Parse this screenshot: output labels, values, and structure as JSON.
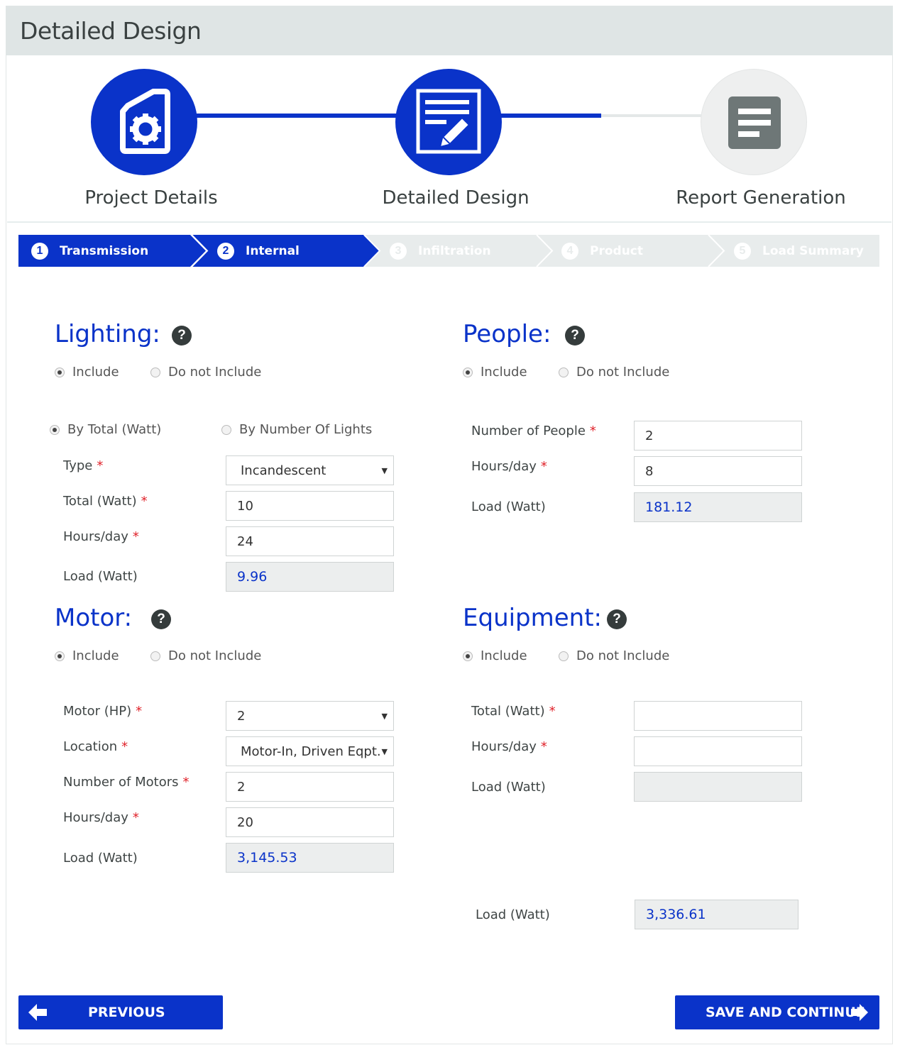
{
  "header": {
    "title": "Detailed Design"
  },
  "steps": [
    {
      "label": "Project Details",
      "icon": "document-gear-icon",
      "state": "complete"
    },
    {
      "label": "Detailed Design",
      "icon": "edit-document-icon",
      "state": "active"
    },
    {
      "label": "Report Generation",
      "icon": "list-document-icon",
      "state": "pending"
    }
  ],
  "crumbs": [
    {
      "num": "1",
      "label": "Transmission"
    },
    {
      "num": "2",
      "label": "Internal"
    },
    {
      "num": "3",
      "label": "Infiltration"
    },
    {
      "num": "4",
      "label": "Product"
    },
    {
      "num": "5",
      "label": "Load Summary"
    }
  ],
  "common": {
    "include": "Include",
    "exclude": "Do not Include",
    "required": "*",
    "help": "?"
  },
  "lighting": {
    "title": "Lighting:",
    "mode_total": "By Total (Watt)",
    "mode_count": "By Number Of Lights",
    "type_label": "Type",
    "type_value": "Incandescent",
    "total_label": "Total (Watt)",
    "total_value": "10",
    "hours_label": "Hours/day",
    "hours_value": "24",
    "load_label": "Load (Watt)",
    "load_value": "9.96"
  },
  "people": {
    "title": "People:",
    "number_label": "Number of People",
    "number_value": "2",
    "hours_label": "Hours/day",
    "hours_value": "8",
    "load_label": "Load (Watt)",
    "load_value": "181.12"
  },
  "motor": {
    "title": "Motor:",
    "hp_label": "Motor (HP)",
    "hp_value": "2",
    "location_label": "Location",
    "location_value": "Motor-In, Driven Eqpt.",
    "count_label": "Number of Motors",
    "count_value": "2",
    "hours_label": "Hours/day",
    "hours_value": "20",
    "load_label": "Load (Watt)",
    "load_value": "3,145.53"
  },
  "equipment": {
    "title": "Equipment:",
    "total_label": "Total (Watt)",
    "total_value": "",
    "hours_label": "Hours/day",
    "hours_value": "",
    "load_label": "Load (Watt)",
    "load_value": ""
  },
  "summary": {
    "load_label": "Load (Watt)",
    "load_value": "3,336.61"
  },
  "buttons": {
    "previous": "PREVIOUS",
    "save": "SAVE AND CONTINUE"
  },
  "colors": {
    "accent": "#0a33c9",
    "header_bg": "#dfe5e5",
    "inactive": "#e8ecec",
    "icon_grey": "#6e7777"
  }
}
